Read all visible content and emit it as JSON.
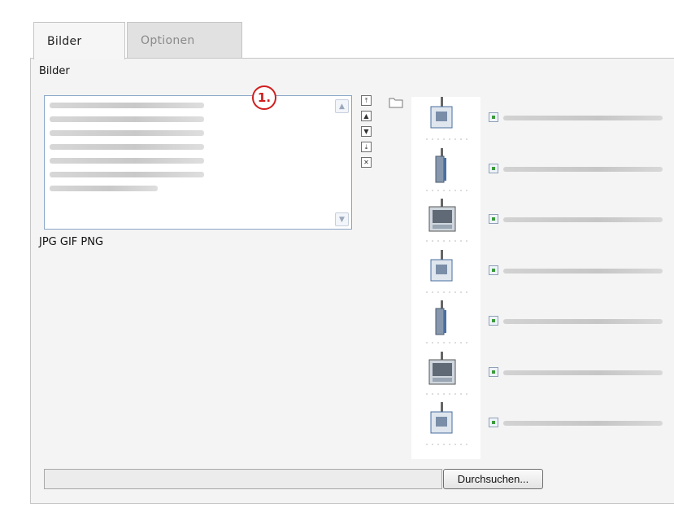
{
  "tabs": [
    {
      "label": "Bilder",
      "active": true
    },
    {
      "label": "Optionen",
      "active": false
    }
  ],
  "panel": {
    "section_label": "Bilder",
    "callout_label": "1.",
    "allowed_filetypes": "JPG GIF PNG",
    "list_item_count": 7,
    "controls": [
      {
        "name": "move-top-button",
        "glyph": "⤒"
      },
      {
        "name": "move-up-button",
        "glyph": "▲"
      },
      {
        "name": "move-down-button",
        "glyph": "▼"
      },
      {
        "name": "move-bottom-button",
        "glyph": "⤓"
      },
      {
        "name": "remove-button",
        "glyph": "✕"
      }
    ],
    "thumbnail_count": 7,
    "browse_button_label": "Durchsuchen...",
    "file_input_value": ""
  },
  "colors": {
    "callout_red": "#d11d1d",
    "listbox_border": "#8aa6c8",
    "panel_bg": "#f4f4f4"
  }
}
